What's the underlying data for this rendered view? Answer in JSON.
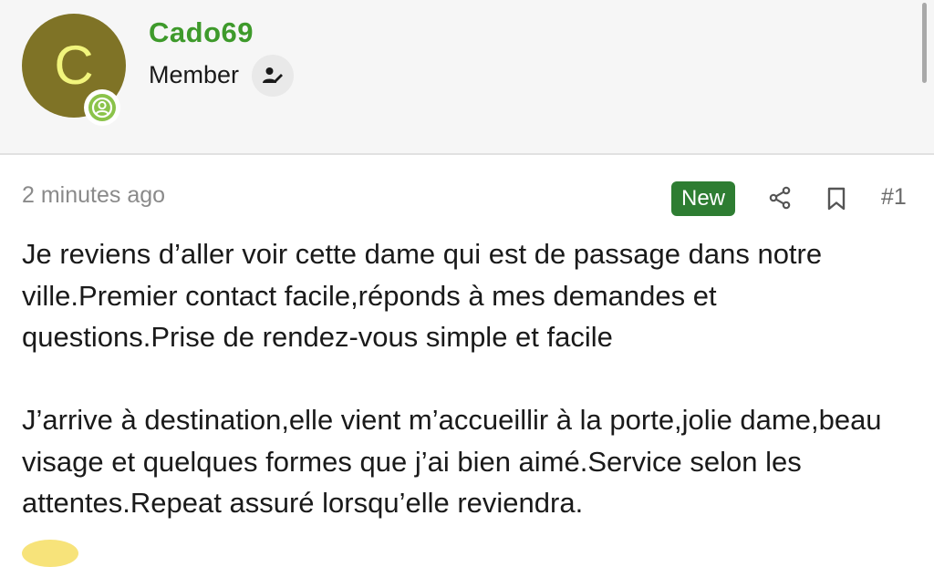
{
  "user": {
    "avatar_letter": "C",
    "username": "Cado69",
    "role": "Member",
    "avatar_color": "#7f7326",
    "username_color": "#3e9a2b",
    "online_icon": "user-circle-icon",
    "role_icon": "user-edit-icon"
  },
  "post": {
    "timestamp": "2 minutes ago",
    "new_label": "New",
    "post_number": "#1",
    "share_icon": "share-icon",
    "bookmark_icon": "bookmark-icon",
    "paragraphs": [
      "Je reviens d’aller voir cette dame qui est de passage dans notre ville.Premier contact facile,réponds à mes demandes et questions.Prise de rendez-vous simple et facile",
      "J’arrive à destination,elle vient m’accueillir à la porte,jolie dame,beau visage et quelques formes que j’ai bien aimé.Service selon les attentes.Repeat assuré lorsqu’elle reviendra."
    ]
  }
}
